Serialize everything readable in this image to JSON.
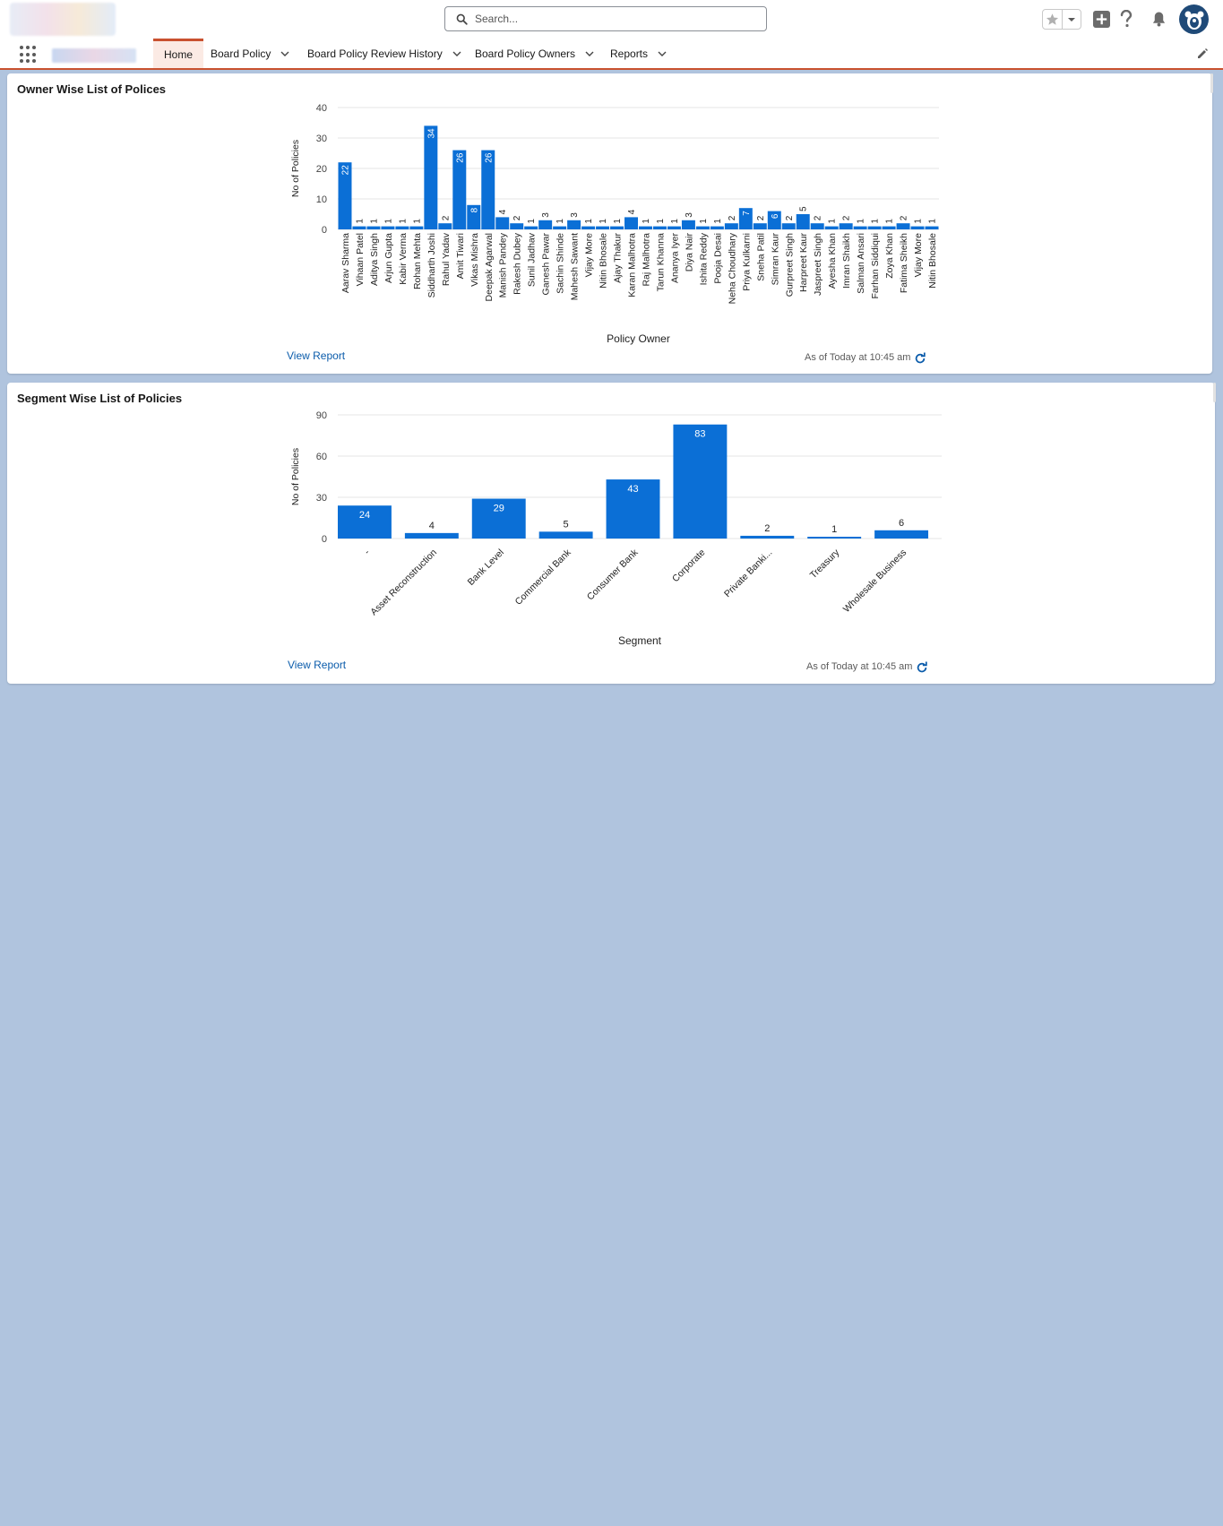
{
  "header": {
    "search_placeholder": "Search...",
    "icons": [
      "star-icon",
      "chevron-down-icon",
      "add-icon",
      "help-icon",
      "bell-icon",
      "avatar-icon"
    ]
  },
  "nav": {
    "tabs": [
      {
        "label": "Home",
        "active": true
      },
      {
        "label": "Board Policy",
        "active": false
      },
      {
        "label": "Board Policy Review History",
        "active": false
      },
      {
        "label": "Board Policy Owners",
        "active": false
      },
      {
        "label": "Reports",
        "active": false
      }
    ]
  },
  "card1": {
    "title": "Owner Wise List of Polices",
    "view_report": "View Report",
    "as_of": "As of Today at 10:45 am"
  },
  "card2": {
    "title": "Segment Wise List of Policies",
    "view_report": "View Report",
    "as_of": "As of Today at 10:45 am"
  },
  "colors": {
    "bar": "#0b6fd6",
    "accent": "#c9512f",
    "link": "#0b5cab",
    "background": "#b0c4de"
  },
  "chart_data": [
    {
      "type": "bar",
      "xlabel": "Policy Owner",
      "ylabel": "No of Policies",
      "ylim": [
        0,
        40
      ],
      "yticks": [
        0,
        10,
        20,
        30,
        40
      ],
      "grid": true,
      "categories": [
        "Aarav Sharma",
        "Vihaan Patel",
        "Aditya Singh",
        "Arjun Gupta",
        "Kabir Verma",
        "Rohan Mehta",
        "Siddharth Joshi",
        "Rahul Yadav",
        "Amit Tiwari",
        "Vikas Mishra",
        "Deepak Agarwal",
        "Manish Pandey",
        "Rakesh Dubey",
        "Sunil Jadhav",
        "Ganesh Pawar",
        "Sachin Shinde",
        "Mahesh Sawant",
        "Vijay More",
        "Nitin Bhosale",
        "Ajay Thakur",
        "Karan Malhotra",
        "Raj Malhotra",
        "Tarun Khanna",
        "Ananya Iyer",
        "Diya Nair",
        "Ishita Reddy",
        "Pooja Desai",
        "Neha Choudhary",
        "Priya Kulkarni",
        "Sneha Patil",
        "Simran Kaur",
        "Gurpreet Singh",
        "Harpreet Kaur",
        "Jaspreet Singh",
        "Ayesha Khan",
        "Imran Shaikh",
        "Salman Ansari",
        "Farhan Siddiqui",
        "Zoya Khan",
        "Fatima Sheikh",
        "Vijay More",
        "Nitin Bhosale"
      ],
      "values": [
        22,
        1,
        1,
        1,
        1,
        1,
        34,
        2,
        26,
        8,
        26,
        4,
        2,
        1,
        3,
        1,
        3,
        1,
        1,
        1,
        4,
        1,
        1,
        1,
        3,
        1,
        1,
        2,
        7,
        2,
        6,
        2,
        5,
        2,
        1,
        2,
        1,
        1,
        1,
        2,
        1,
        1
      ],
      "labels": [
        "22",
        "1",
        "1",
        "1",
        "1",
        "1",
        "34",
        "2",
        "26",
        "8",
        "26",
        "4",
        "2",
        "1",
        "3",
        "1",
        "3",
        "1",
        "1",
        "1",
        "4",
        "1",
        "1",
        "1",
        "3",
        "1",
        "1",
        "2",
        "7",
        "2",
        "6",
        "2",
        "5",
        "2",
        "1",
        "2",
        "1",
        "1",
        "1",
        "2",
        "1",
        "1"
      ]
    },
    {
      "type": "bar",
      "xlabel": "Segment",
      "ylabel": "No of Policies",
      "ylim": [
        0,
        90
      ],
      "yticks": [
        0,
        30,
        60,
        90
      ],
      "grid": true,
      "categories": [
        "-",
        "Asset Reconstruction",
        "Bank Level",
        "Commercial Bank",
        "Consumer Bank",
        "Corporate",
        "Private Banki...",
        "Treasury",
        "Wholesale Business"
      ],
      "values": [
        24,
        4,
        29,
        5,
        43,
        83,
        2,
        1,
        6
      ]
    }
  ]
}
